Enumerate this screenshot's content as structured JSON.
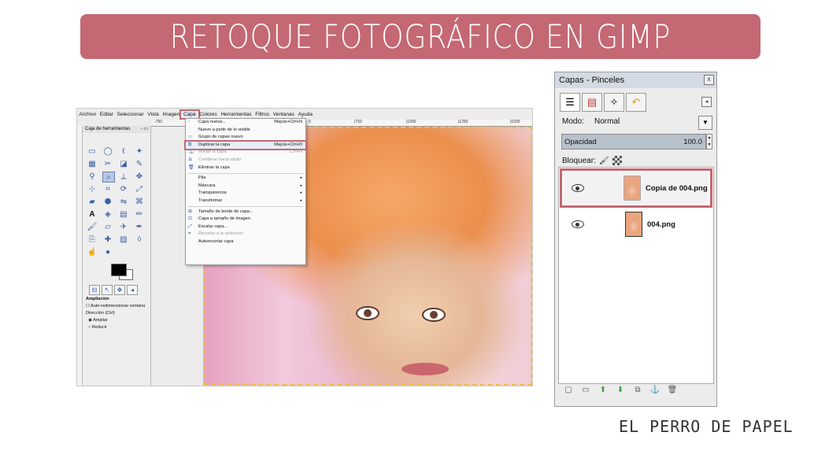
{
  "banner": {
    "title": "RETOQUE FOTOGRÁFICO EN GIMP"
  },
  "footer": {
    "text": "EL PERRO DE PAPEL"
  },
  "gimp": {
    "menubar": [
      "Archivo",
      "Editar",
      "Seleccionar",
      "Vista",
      "Imagen",
      "Capa",
      "Colores",
      "Herramientas",
      "Filtros",
      "Ventanas",
      "Ayuda"
    ],
    "ruler_ticks": [
      "-750",
      "0",
      "|750",
      "|1000",
      "|1250",
      "|1500"
    ],
    "toolbox": {
      "title": "Caja de herramientas",
      "title_buttons": "- ▭",
      "options_title": "Ampliación",
      "auto_resize": "Auto-redimensionar ventana",
      "direction_label": "Dirección (Ctrl)",
      "options": [
        "Ampliar",
        "Reducir"
      ]
    },
    "capa_menu": [
      {
        "label": "Capa nueva...",
        "shortcut": "Mayús+Ctrl+N",
        "icon": "new-layer-icon",
        "disabled": false
      },
      {
        "label": "Nuevo a partir de lo visible",
        "shortcut": "",
        "icon": "",
        "disabled": false
      },
      {
        "label": "Grupo de capas nuevo",
        "shortcut": "",
        "icon": "group-icon",
        "disabled": false
      },
      {
        "label": "Duplicar la capa",
        "shortcut": "Mayús+Ctrl+D",
        "icon": "duplicate-icon",
        "disabled": false,
        "highlighted": true
      },
      {
        "label": "Anclar la capa",
        "shortcut": "Ctrl+H",
        "icon": "anchor-icon",
        "disabled": true
      },
      {
        "label": "Combinar hacia abajo",
        "shortcut": "",
        "icon": "merge-icon",
        "disabled": true
      },
      {
        "label": "Eliminar la capa",
        "shortcut": "",
        "icon": "delete-icon",
        "disabled": false
      },
      {
        "separator": true
      },
      {
        "label": "Pila",
        "submenu": true
      },
      {
        "label": "Máscara",
        "submenu": true
      },
      {
        "label": "Transparencia",
        "submenu": true
      },
      {
        "label": "Transformar",
        "submenu": true
      },
      {
        "separator": true
      },
      {
        "label": "Tamaño de borde de capa...",
        "shortcut": "",
        "icon": "border-size-icon",
        "disabled": false
      },
      {
        "label": "Capa a tamaño de imagen",
        "shortcut": "",
        "icon": "fit-icon",
        "disabled": false
      },
      {
        "label": "Escalar capa...",
        "shortcut": "",
        "icon": "scale-icon",
        "disabled": false
      },
      {
        "label": "Recortar a la selección",
        "shortcut": "",
        "icon": "crop-icon",
        "disabled": true
      },
      {
        "label": "Autorecortar capa",
        "shortcut": "",
        "icon": "",
        "disabled": false
      }
    ]
  },
  "layers": {
    "title": "Capas - Pinceles",
    "close": "x",
    "menu_button": "◂",
    "mode_label": "Modo:",
    "mode_value": "Normal",
    "opacity_label": "Opacidad",
    "opacity_value": "100.0",
    "lock_label": "Bloquear:",
    "items": [
      {
        "name": "Copia de 004.png",
        "selected": true
      },
      {
        "name": "004.png",
        "selected": false
      }
    ]
  },
  "colors": {
    "accent": "#c46873",
    "banner_text": "#ffffff"
  }
}
